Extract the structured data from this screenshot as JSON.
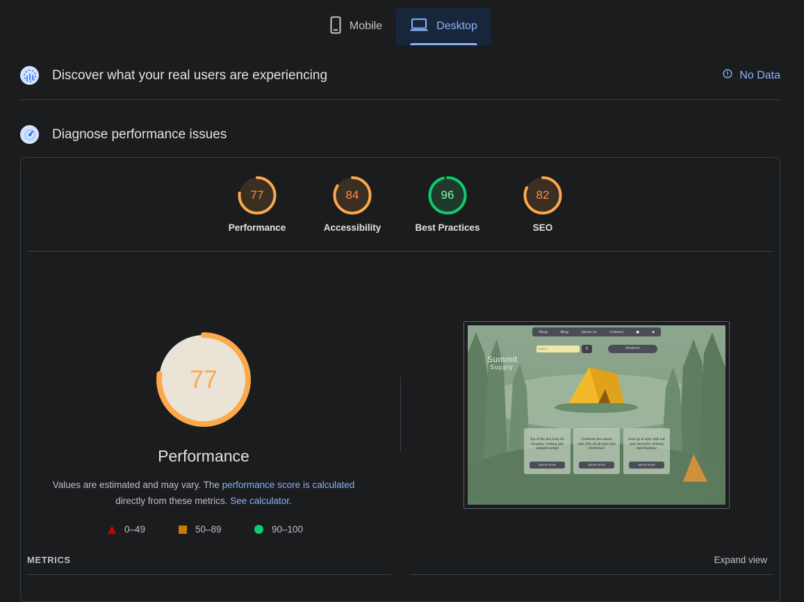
{
  "device_tabs": {
    "mobile": "Mobile",
    "desktop": "Desktop",
    "selected": "desktop"
  },
  "field_data": {
    "title": "Discover what your real users are experiencing",
    "status": "No Data"
  },
  "lab_data": {
    "title": "Diagnose performance issues"
  },
  "scores": [
    {
      "label": "Performance",
      "value": "77",
      "score": 77,
      "color": "#fba94b"
    },
    {
      "label": "Accessibility",
      "value": "84",
      "score": 84,
      "color": "#fba94b"
    },
    {
      "label": "Best Practices",
      "value": "96",
      "score": 96,
      "color": "#0cce6b"
    },
    {
      "label": "SEO",
      "value": "82",
      "score": 82,
      "color": "#fba94b"
    }
  ],
  "main_gauge": {
    "value": "77",
    "score": 77,
    "title": "Performance"
  },
  "note": {
    "prefix": "Values are estimated and may vary. The ",
    "link1": "performance score is calculated",
    "middle": "directly from these metrics.",
    "link2": "See calculator."
  },
  "legend": [
    {
      "range": "0–49",
      "color": "#cc0000",
      "shape": "triangle"
    },
    {
      "range": "50–89",
      "color": "#c87b00",
      "shape": "square"
    },
    {
      "range": "90–100",
      "color": "#0cce6b",
      "shape": "circle"
    }
  ],
  "metrics": {
    "label": "METRICS",
    "expand": "Expand view"
  },
  "screenshot": {
    "nav": [
      "Shop",
      "Blog",
      "About us",
      "Contact"
    ],
    "search_placeholder": "Search",
    "dropdown": "Products",
    "logo_line1": "Summit",
    "logo_line2": "Supply",
    "cards": [
      {
        "text": "Top of the line tools for foraging, cooking and campsite setup!",
        "button": "SHOP NOW"
      },
      {
        "text": "Celebrate the season with 30% off all tents this Christmas!",
        "button": "SHOP NOW"
      },
      {
        "text": "Gear up in style with our new exclusive clothing merchandise!",
        "button": "SHOP NOW"
      }
    ]
  },
  "colors": {
    "accent": "#8ab4f8",
    "average": "#fba94b",
    "pass": "#0cce6b",
    "fail": "#cc0000"
  }
}
